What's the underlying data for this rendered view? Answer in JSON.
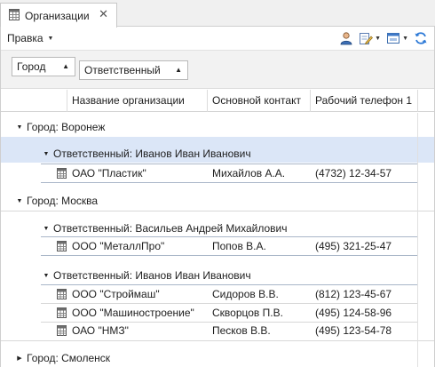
{
  "tab": {
    "title": "Организации",
    "icon": "table-icon",
    "close": "✕"
  },
  "toolbar": {
    "menu_label": "Правка",
    "buttons": [
      "user-icon",
      "edit-document-icon",
      "window-icon",
      "refresh-icon"
    ]
  },
  "group_panel": {
    "chips": [
      {
        "label": "Город",
        "sort": "▲"
      },
      {
        "label": "Ответственный",
        "sort": "▲"
      }
    ]
  },
  "columns": [
    "Название организации",
    "Основной контакт",
    "Рабочий телефон 1"
  ],
  "groups": [
    {
      "label": "Город: Воронеж",
      "expanded": true,
      "subgroups": [
        {
          "label": "Ответственный: Иванов Иван Иванович",
          "expanded": true,
          "selected": true,
          "rows": [
            {
              "name": "ОАО \"Пластик\"",
              "contact": "Михайлов А.А.",
              "phone": "(4732) 12-34-57"
            }
          ]
        }
      ]
    },
    {
      "label": "Город: Москва",
      "expanded": true,
      "subgroups": [
        {
          "label": "Ответственный: Васильев Андрей Михайлович",
          "expanded": true,
          "rows": [
            {
              "name": "ООО \"МеталлПро\"",
              "contact": "Попов В.А.",
              "phone": "(495) 321-25-47"
            }
          ]
        },
        {
          "label": "Ответственный: Иванов Иван Иванович",
          "expanded": true,
          "rows": [
            {
              "name": "ООО \"Строймаш\"",
              "contact": "Сидоров В.В.",
              "phone": "(812) 123-45-67"
            },
            {
              "name": "ООО \"Машиностроение\"",
              "contact": "Скворцов П.В.",
              "phone": "(495) 124-58-96"
            },
            {
              "name": "ОАО \"НМЗ\"",
              "contact": "Песков В.В.",
              "phone": "(495) 123-54-78"
            }
          ]
        }
      ]
    },
    {
      "label": "Город: Смоленск",
      "expanded": false,
      "subgroups": []
    }
  ],
  "colors": {
    "selection": "#dbe6f7",
    "accent": "#2b78d6",
    "grid_line": "#d8d8d8"
  }
}
